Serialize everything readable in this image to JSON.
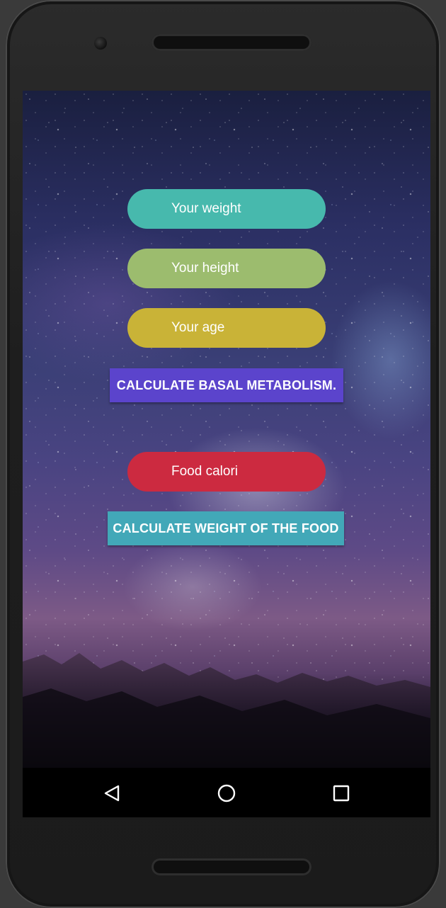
{
  "colors": {
    "weight_field": "#47b9ad",
    "height_field": "#9cbc6e",
    "age_field": "#c9b337",
    "basal_button": "#5b44cc",
    "food_field": "#cc2a40",
    "food_button": "#42a8b8"
  },
  "form": {
    "weight_placeholder": "Your weight",
    "height_placeholder": "Your height",
    "age_placeholder": "Your age",
    "basal_button_label": "CALCULATE BASAL METABOLISM.",
    "food_placeholder": "Food calori",
    "food_button_label": "CALCULATE WEIGHT OF THE FOOD"
  },
  "navbar": {
    "back_icon": "back-triangle-icon",
    "home_icon": "home-circle-icon",
    "recents_icon": "recents-square-icon"
  }
}
